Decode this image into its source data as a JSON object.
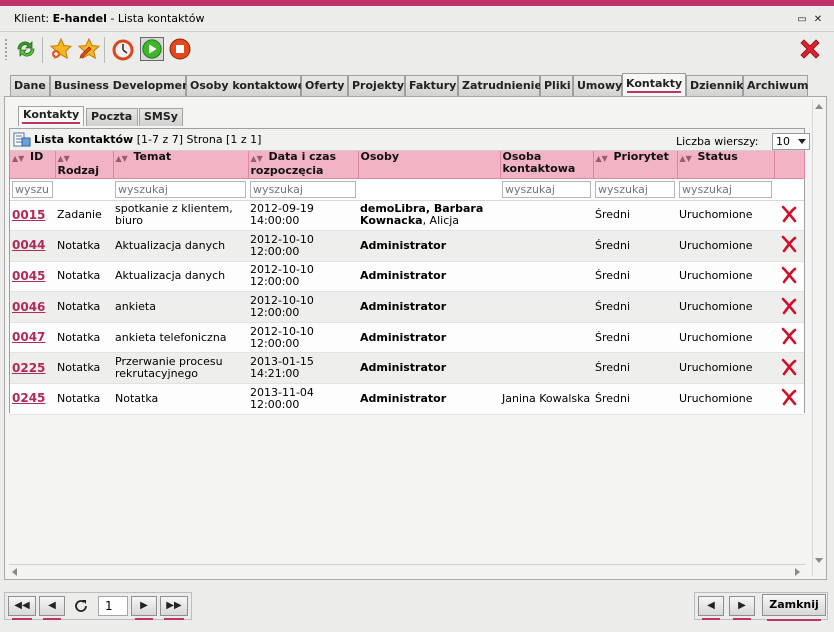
{
  "window": {
    "title_prefix": "Klient:",
    "client_name": "E-handel",
    "title_suffix": "- Lista kontaktów",
    "minimize_glyph": "▭",
    "close_glyph": "✕"
  },
  "toolbar": {
    "icons": [
      "refresh-arrows-icon",
      "star-add-icon",
      "star-edit-icon",
      "stopwatch-icon",
      "play-icon",
      "stop-icon",
      "close-red-x-icon"
    ]
  },
  "tabs": [
    {
      "label": "Dane"
    },
    {
      "label": "Business Development"
    },
    {
      "label": "Osoby kontaktowe"
    },
    {
      "label": "Oferty"
    },
    {
      "label": "Projekty"
    },
    {
      "label": "Faktury"
    },
    {
      "label": "Zatrudnienie"
    },
    {
      "label": "Pliki"
    },
    {
      "label": "Umowy"
    },
    {
      "label": "Kontakty",
      "active": true
    },
    {
      "label": "Dziennik"
    },
    {
      "label": "Archiwum"
    }
  ],
  "subtabs": [
    {
      "label": "Kontakty",
      "active": true
    },
    {
      "label": "Poczta"
    },
    {
      "label": "SMSy"
    }
  ],
  "grid": {
    "caption_title": "Lista kontaktów",
    "caption_info": "[1-7 z 7] Strona [1 z 1]",
    "rows_label": "Liczba wierszy:",
    "rows_value": "10",
    "columns": [
      {
        "label": "ID"
      },
      {
        "label": "Rodzaj"
      },
      {
        "label": "Temat"
      },
      {
        "label": "Data i czas rozpoczęcia"
      },
      {
        "label": "Osoby"
      },
      {
        "label": "Osoba kontaktowa"
      },
      {
        "label": "Priorytet"
      },
      {
        "label": "Status"
      }
    ],
    "filter_placeholder": "wyszukaj",
    "rows": [
      {
        "id": "0015",
        "type": "Zadanie",
        "topic": "spotkanie z klientem, biuro",
        "date": "2012-09-19",
        "time": "14:00:00",
        "people_bold": "demoLibra, Barbara Kownacka",
        "people_rest": ", Alicja",
        "contact": "",
        "priority": "Średni",
        "status": "Uruchomione"
      },
      {
        "id": "0044",
        "type": "Notatka",
        "topic": "Aktualizacja danych",
        "date": "2012-10-10",
        "time": "12:00:00",
        "people_bold": "Administrator",
        "people_rest": "",
        "contact": "",
        "priority": "Średni",
        "status": "Uruchomione"
      },
      {
        "id": "0045",
        "type": "Notatka",
        "topic": "Aktualizacja danych",
        "date": "2012-10-10",
        "time": "12:00:00",
        "people_bold": "Administrator",
        "people_rest": "",
        "contact": "",
        "priority": "Średni",
        "status": "Uruchomione"
      },
      {
        "id": "0046",
        "type": "Notatka",
        "topic": "ankieta",
        "date": "2012-10-10",
        "time": "12:00:00",
        "people_bold": "Administrator",
        "people_rest": "",
        "contact": "",
        "priority": "Średni",
        "status": "Uruchomione"
      },
      {
        "id": "0047",
        "type": "Notatka",
        "topic": "ankieta telefoniczna",
        "date": "2012-10-10",
        "time": "12:00:00",
        "people_bold": "Administrator",
        "people_rest": "",
        "contact": "",
        "priority": "Średni",
        "status": "Uruchomione"
      },
      {
        "id": "0225",
        "type": "Notatka",
        "topic": "Przerwanie procesu rekrutacyjnego",
        "date": "2013-01-15",
        "time": "14:21:00",
        "people_bold": "Administrator",
        "people_rest": "",
        "contact": "",
        "priority": "Średni",
        "status": "Uruchomione"
      },
      {
        "id": "0245",
        "type": "Notatka",
        "topic": "Notatka",
        "date": "2013-11-04",
        "time": "12:00:00",
        "people_bold": "Administrator",
        "people_rest": "",
        "contact": "Janina Kowalska",
        "priority": "Średni",
        "status": "Uruchomione"
      }
    ]
  },
  "pager": {
    "first": "◀◀",
    "prev": "◀",
    "reload_icon": "refresh-icon",
    "page": "1",
    "next": "▶",
    "last": "▶▶"
  },
  "footer": {
    "back": "◀",
    "forward": "▶",
    "close_label": "Zamknij"
  },
  "colors": {
    "accent": "#c0336a",
    "header_row": "#f2b3c4",
    "delete_x": "#d0102a"
  }
}
